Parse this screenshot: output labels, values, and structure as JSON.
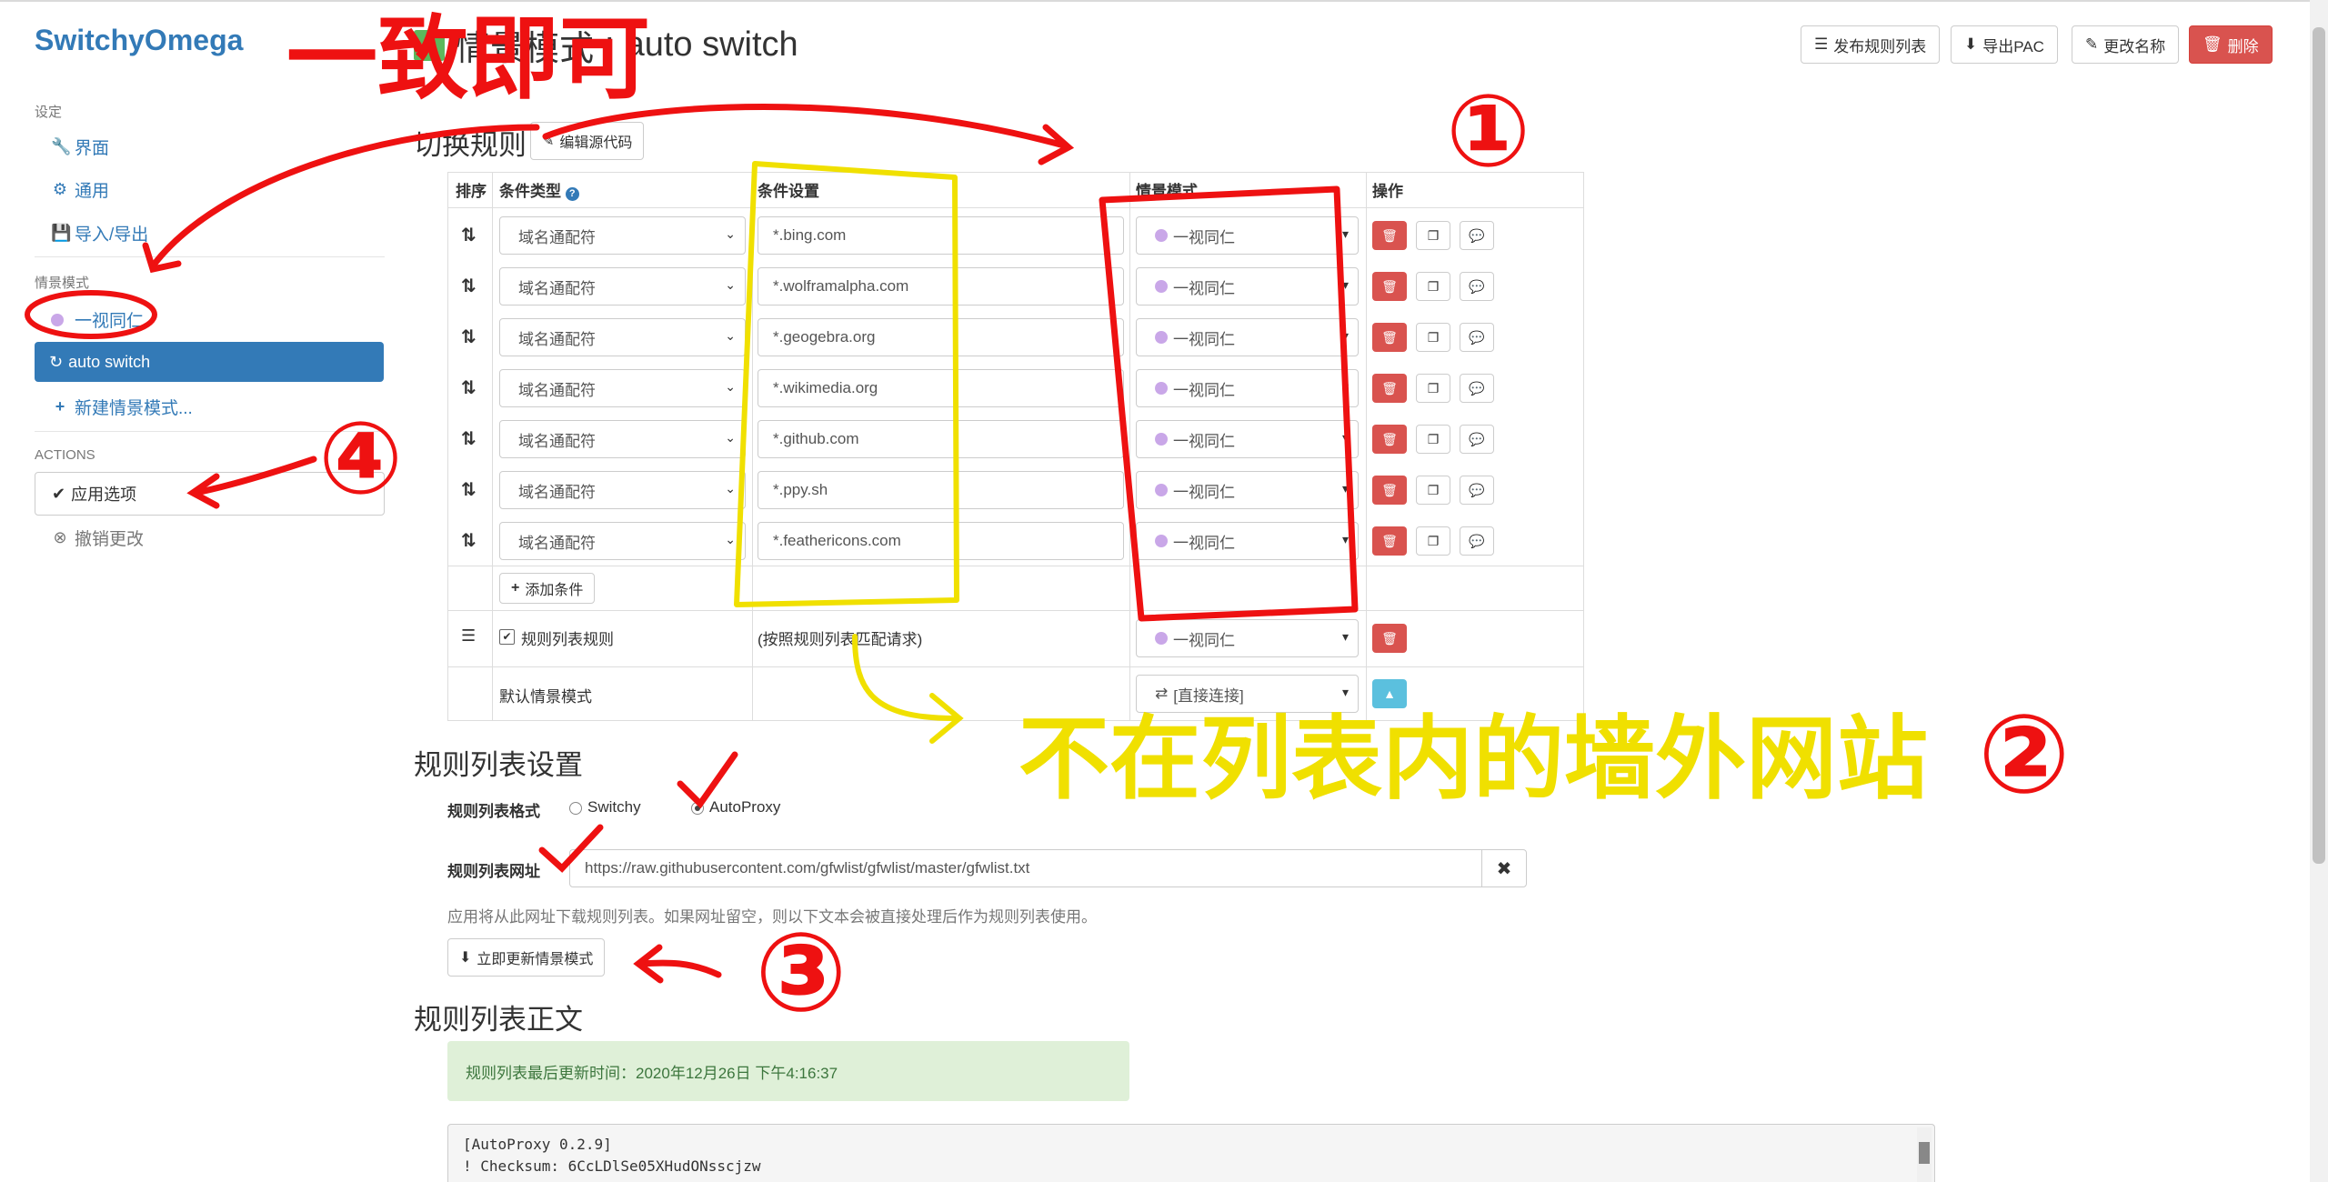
{
  "brand": "SwitchyOmega",
  "sidebar": {
    "settings_header": "设定",
    "items": [
      {
        "label": "界面",
        "icon": "wrench-icon"
      },
      {
        "label": "通用",
        "icon": "gear-icon"
      },
      {
        "label": "导入/导出",
        "icon": "floppy-icon"
      }
    ],
    "profiles_header": "情景模式",
    "profiles": [
      {
        "label": "一视同仁",
        "icon": "globe-icon"
      },
      {
        "label": "auto switch",
        "icon": "retweet-icon"
      }
    ],
    "new_profile": "新建情景模式...",
    "actions_header": "ACTIONS",
    "apply": "应用选项",
    "discard": "撤销更改"
  },
  "header": {
    "title_prefix": "情景模式",
    "title_name": "auto switch",
    "buttons": {
      "publish": "发布规则列表",
      "export_pac": "导出PAC",
      "rename": "更改名称",
      "delete": "删除"
    }
  },
  "switch_rules": {
    "title": "切换规则",
    "edit_source": "编辑源代码",
    "columns": {
      "order": "排序",
      "type": "条件类型",
      "condition": "条件设置",
      "profile": "情景模式",
      "actions": "操作"
    },
    "rows": [
      {
        "type": "域名通配符",
        "condition": "*.bing.com",
        "profile": "一视同仁"
      },
      {
        "type": "域名通配符",
        "condition": "*.wolframalpha.com",
        "profile": "一视同仁"
      },
      {
        "type": "域名通配符",
        "condition": "*.geogebra.org",
        "profile": "一视同仁"
      },
      {
        "type": "域名通配符",
        "condition": "*.wikimedia.org",
        "profile": "一视同仁"
      },
      {
        "type": "域名通配符",
        "condition": "*.github.com",
        "profile": "一视同仁"
      },
      {
        "type": "域名通配符",
        "condition": "*.ppy.sh",
        "profile": "一视同仁"
      },
      {
        "type": "域名通配符",
        "condition": "*.feathericons.com",
        "profile": "一视同仁"
      }
    ],
    "add_condition": "添加条件",
    "rulelist_row": {
      "label": "规则列表规则",
      "condition": "(按照规则列表匹配请求)",
      "profile": "一视同仁"
    },
    "default_row": {
      "label": "默认情景模式",
      "profile": "[直接连接]"
    }
  },
  "rulelist_settings": {
    "title": "规则列表设置",
    "format_label": "规则列表格式",
    "format_options": [
      "Switchy",
      "AutoProxy"
    ],
    "format_selected": "AutoProxy",
    "url_label": "规则列表网址",
    "url": "https://raw.githubusercontent.com/gfwlist/gfwlist/master/gfwlist.txt",
    "help": "应用将从此网址下载规则列表。如果网址留空，则以下文本会被直接处理后作为规则列表使用。",
    "update_now": "立即更新情景模式"
  },
  "rulelist_text": {
    "title": "规则列表正文",
    "last_updated": "规则列表最后更新时间：2020年12月26日 下午4:16:37",
    "lines": [
      "[AutoProxy 0.2.9]",
      "! Checksum: 6CcLDlSe05XHudONsscjzw"
    ]
  },
  "annotations": {
    "top_note": "一致即可",
    "yellow_note": "不在列表内的墙外网站",
    "numbers": [
      "①",
      "②",
      "③",
      "④"
    ]
  },
  "colors": {
    "primary": "#337ab7",
    "danger": "#d9534f",
    "info": "#5bc0de",
    "success_bg": "#dff0d8",
    "annotation_red": "#ee1111",
    "annotation_yellow": "#f0e000"
  }
}
